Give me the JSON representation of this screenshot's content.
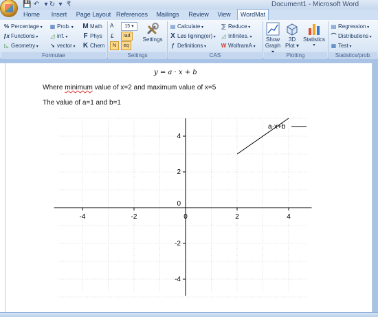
{
  "window": {
    "title": "Document1 - Microsoft Word"
  },
  "quick_access": {
    "save_icon": "save-icon",
    "undo_icon": "undo-icon",
    "redo_icon": "redo-icon",
    "customize_icon": "customize-icon"
  },
  "tabs": [
    "Home",
    "Insert",
    "Page Layout",
    "References",
    "Mailings",
    "Review",
    "View",
    "WordMat"
  ],
  "active_tab": "WordMat",
  "ribbon": {
    "formulae": {
      "label": "Formulae",
      "col1": [
        "Percentage",
        "Functions",
        "Geometry"
      ],
      "col2": [
        "Prob.",
        "inf.",
        "vector"
      ],
      "col3": [
        "Math",
        "Phys",
        "Chem"
      ]
    },
    "settings": {
      "label": "Settings",
      "decimals_label": "A",
      "decimals_value": "15",
      "currency_label": "£",
      "angle_label": "rad",
      "n_label": "N",
      "eq_label": "eq",
      "settings_button": "Settings"
    },
    "cas": {
      "label": "CAS",
      "col1": [
        "Calculate",
        "Løs ligning(er)",
        "Definitions"
      ],
      "col2": [
        "Reduce",
        "Infinites.",
        "WolframA"
      ]
    },
    "plotting": {
      "label": "Plotting",
      "buttons": [
        "Show Graph",
        "3D Plot",
        "Statistics"
      ]
    },
    "stats": {
      "label": "Statistics/prob.",
      "items": [
        "Regression",
        "Distributions",
        "Test"
      ]
    }
  },
  "document": {
    "formula": "y = a · x + b",
    "line1_prefix": "Where ",
    "line1_misspelled": "minimum",
    "line1_suffix": " value of x=2 and maximum value of x=5",
    "line2": "The value of a=1 and b=1"
  },
  "chart_data": {
    "type": "line",
    "series": [
      {
        "name": "a·x+b",
        "x": [
          2,
          4
        ],
        "y": [
          3,
          5
        ]
      }
    ],
    "xlim": [
      -5,
      5
    ],
    "ylim": [
      -5,
      5
    ],
    "xticks": [
      -4,
      -2,
      0,
      2,
      4
    ],
    "yticks": [
      4,
      2,
      0,
      -2,
      -4
    ],
    "grid": true,
    "legend": "top-right"
  }
}
